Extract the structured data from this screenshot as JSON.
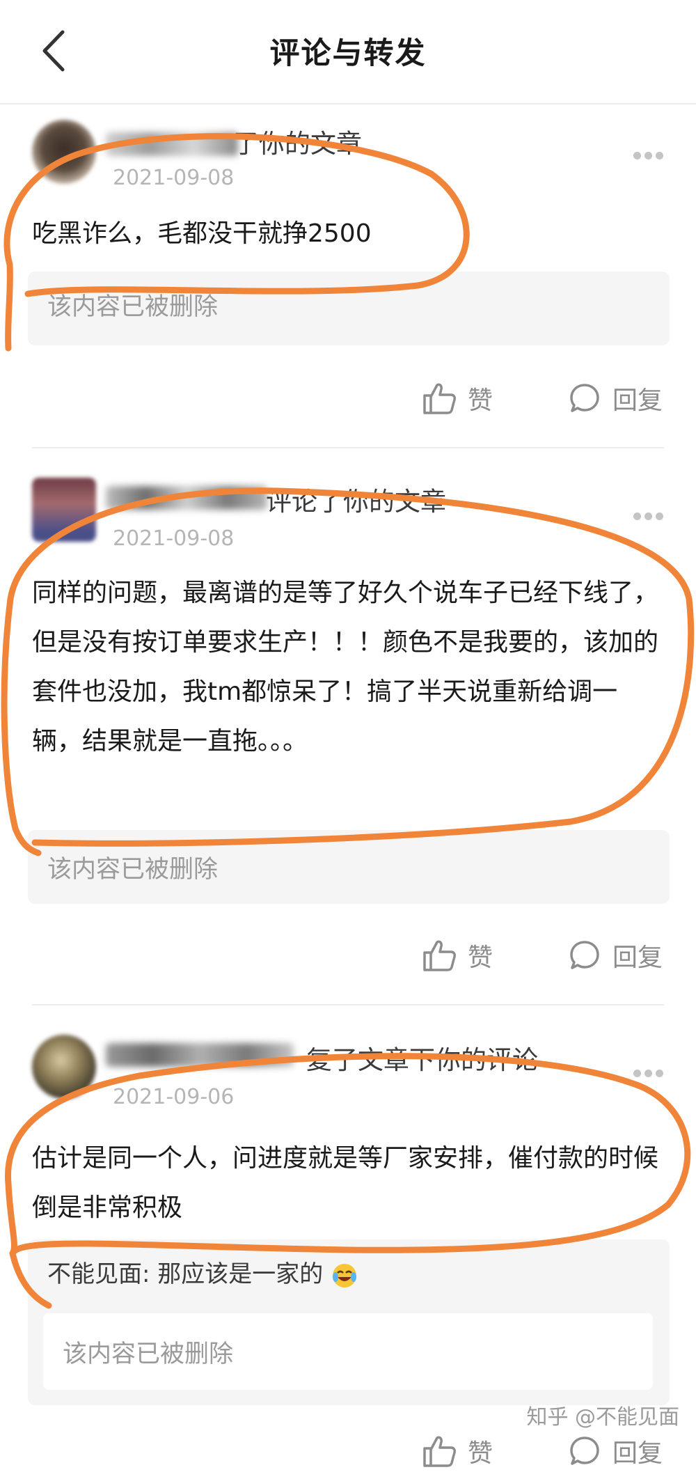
{
  "header": {
    "title": "评论与转发"
  },
  "comments": [
    {
      "action": "了你的文章",
      "date": "2021-09-08",
      "text": "吃黑诈么，毛都没干就挣2500",
      "deleted": "该内容已被删除",
      "like_label": "赞",
      "reply_label": "回复"
    },
    {
      "action": "评论了你的文章",
      "date": "2021-09-08",
      "text": "同样的问题，最离谱的是等了好久个说车子已经下线了，但是没有按订单要求生产！！！颜色不是我要的，该加的套件也没加，我tm都惊呆了！搞了半天说重新给调一辆，结果就是一直拖。。。",
      "deleted": "该内容已被删除",
      "like_label": "赞",
      "reply_label": "回复"
    },
    {
      "action": "复了文章下你的评论",
      "date": "2021-09-06",
      "text": "估计是同一个人，问进度就是等厂家安排，催付款的时候倒是非常积极",
      "reply_quote": "不能见面: 那应该是一家的",
      "deleted": "该内容已被删除",
      "like_label": "赞",
      "reply_label": "回复"
    }
  ],
  "watermark": "知乎 @不能见面",
  "colors": {
    "annotation": "#f0853a",
    "muted": "#9a9a9a",
    "panel": "#f5f5f5"
  }
}
